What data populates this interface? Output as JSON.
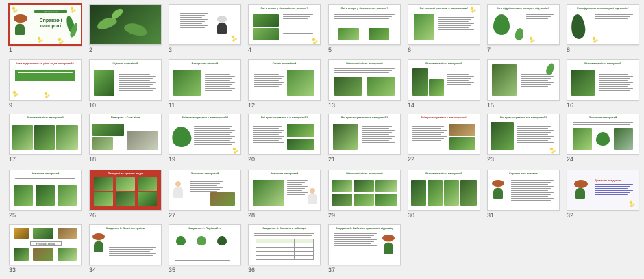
{
  "slides": [
    {
      "num": "1",
      "title": "Справжні папороті",
      "subtitle": "Урок у 5 класі"
    },
    {
      "num": "2",
      "title": ""
    },
    {
      "num": "3",
      "title": "Вивчайте мохоподібні"
    },
    {
      "num": "4",
      "title": "Які є спори у безнасінних рослин?"
    },
    {
      "num": "5",
      "title": "Які є спори у безнасінних рослин?"
    },
    {
      "num": "6",
      "title": "Які спорові рослини є паразитами?"
    },
    {
      "num": "7",
      "title": "Хто відрізняється папороті від мохів?"
    },
    {
      "num": "8",
      "title": "Хто відрізняється папороті від мохів?"
    },
    {
      "num": "9",
      "title": "Чим відрізняються різні види папоротей?"
    },
    {
      "num": "10",
      "title": "Щитник чоловічий"
    },
    {
      "num": "11",
      "title": "Безщитник жіночий"
    },
    {
      "num": "12",
      "title": "Орляк звичайний"
    },
    {
      "num": "13",
      "title": "Різноманітність папоротей"
    },
    {
      "num": "14",
      "title": "Різноманітність папоротей"
    },
    {
      "num": "15",
      "title": ""
    },
    {
      "num": "16",
      "title": "Різноманітність папоротей"
    },
    {
      "num": "17",
      "title": "Різноманітність папоротей"
    },
    {
      "num": "18",
      "title": "Папороть • Сальвінія"
    },
    {
      "num": "19",
      "title": "Які пристосування є в папоротей?"
    },
    {
      "num": "20",
      "title": "Які пристосування є в папоротей?"
    },
    {
      "num": "21",
      "title": "Які пристосування є в папоротей?"
    },
    {
      "num": "22",
      "title": "Які пристосування є в папоротей?"
    },
    {
      "num": "23",
      "title": "Які пристосування є в папоротей?"
    },
    {
      "num": "24",
      "title": "Значення папоротей"
    },
    {
      "num": "25",
      "title": "Значення папоротей"
    },
    {
      "num": "26",
      "title": "Папороті та сучасні люди"
    },
    {
      "num": "27",
      "title": "Значення папоротей"
    },
    {
      "num": "28",
      "title": "Значення папоротей"
    },
    {
      "num": "29",
      "title": "Різноманітність папоротей"
    },
    {
      "num": "30",
      "title": "Різноманітність папоротей"
    },
    {
      "num": "31",
      "title": "Коротко про головне"
    },
    {
      "num": "32",
      "title": "Домашнє завдання"
    },
    {
      "num": "33",
      "title": "Робочий аркуш"
    },
    {
      "num": "34",
      "title": "Завдання 1. Вивчіть терміни"
    },
    {
      "num": "35",
      "title": "Завдання 2. Порівняйте"
    },
    {
      "num": "36",
      "title": "Завдання 3. Заповніть таблицю"
    },
    {
      "num": "37",
      "title": "Завдання 4. Виберіть правильні відповіді"
    }
  ],
  "selected_slide": "1",
  "colors": {
    "accent": "#c0392b",
    "green_title": "#2e6b2e",
    "fern": "#3f8a36",
    "dark_fern": "#2f5e2a",
    "background": "#f0f0f0"
  }
}
